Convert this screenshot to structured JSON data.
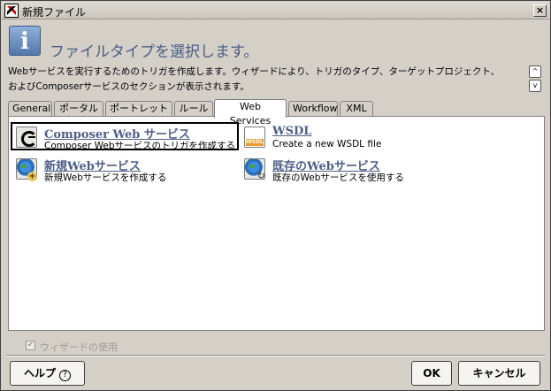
{
  "window": {
    "title": "新規ファイル",
    "close_label": "×"
  },
  "header": {
    "icon_glyph": "i",
    "title": "ファイルタイプを選択します。"
  },
  "description": {
    "line1": "Webサービスを実行するためのトリガを作成します。ウィザードにより、トリガのタイプ、ターゲットプロジェクト、",
    "line2": "およびComposerサービスのセクションが表示されます。",
    "scroll_up": "^",
    "scroll_down": "v"
  },
  "tabs": [
    {
      "label": "General"
    },
    {
      "label": "ポータル"
    },
    {
      "label": "ポートレット"
    },
    {
      "label": "ルール"
    },
    {
      "label": "Web Services"
    },
    {
      "label": "Workflow"
    },
    {
      "label": "XML"
    }
  ],
  "active_tab": "Web Services",
  "items": [
    {
      "title": "Composer Web サービス",
      "desc": "Composer Webサービスのトリガを作成する",
      "icon": "composer-icon"
    },
    {
      "title": "WSDL",
      "desc": "Create a new WSDL file",
      "icon": "wsdl-icon"
    },
    {
      "title": "新規Webサービス",
      "desc": "新規Webサービスを作成する",
      "icon": "globe-plus-icon"
    },
    {
      "title": "既存のWebサービス",
      "desc": "既存のWebサービスを使用する",
      "icon": "globe-arrow-icon"
    }
  ],
  "wizard_checkbox": {
    "label": "ウィザードの使用",
    "checked": true,
    "enabled": false,
    "mark": "✔"
  },
  "buttons": {
    "help": "ヘルプ",
    "help_glyph": "?",
    "ok": "OK",
    "cancel": "キャンセル"
  },
  "colors": {
    "link_title": "#4f5e86",
    "header_title": "#4b5d86",
    "dialog_bg": "#d4d0c8"
  }
}
